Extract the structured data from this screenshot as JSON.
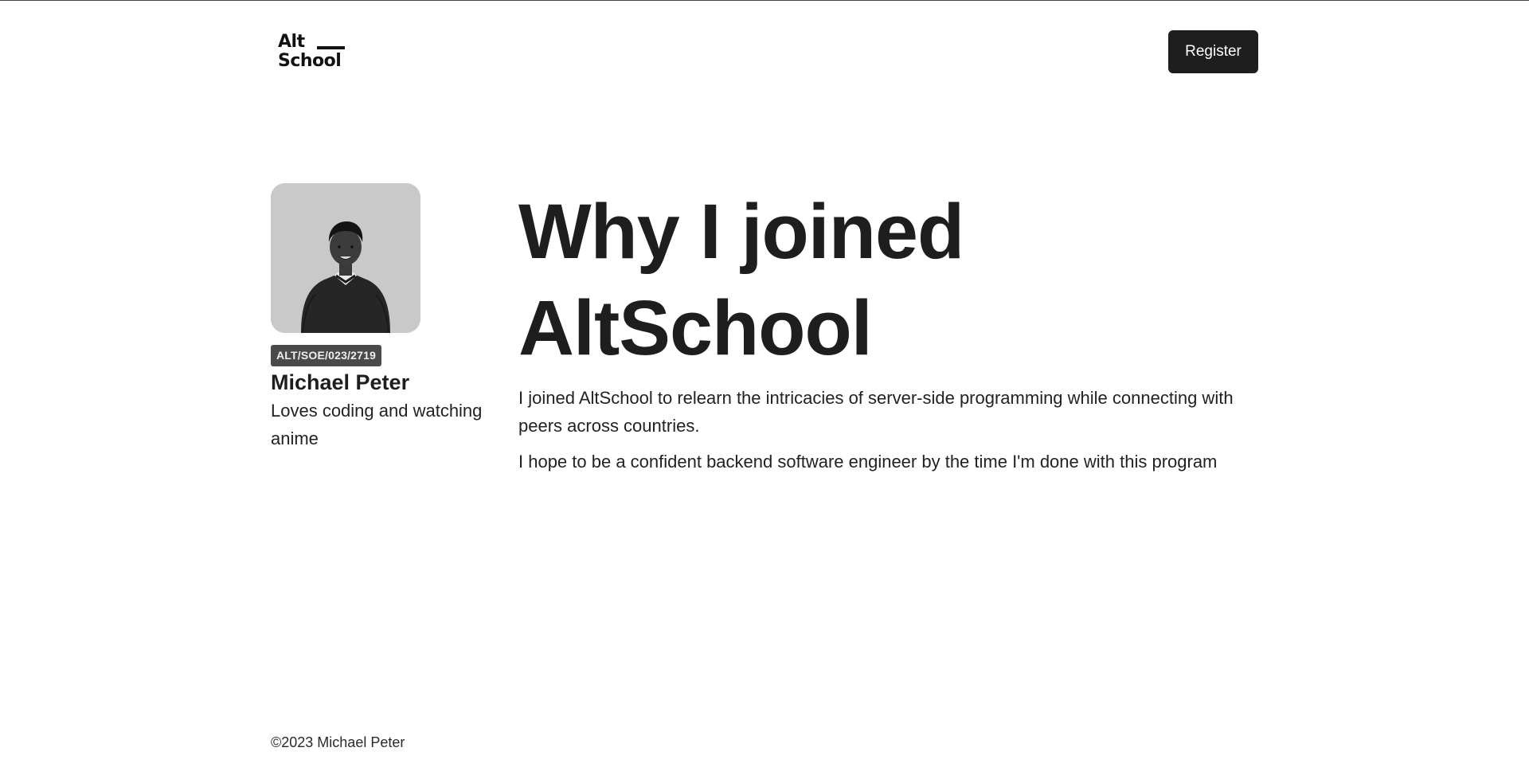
{
  "header": {
    "logo_line1": "Alt",
    "logo_line2": "School",
    "register_label": "Register"
  },
  "profile": {
    "photo_icon": "person-photo",
    "student_id": "ALT/SOE/023/2719",
    "name": "Michael Peter",
    "bio": "Loves coding and watching anime"
  },
  "article": {
    "title_line1": "Why I joined",
    "title_line2": "AltSchool",
    "paragraphs": [
      "I joined AltSchool to relearn the intricacies of server-side programming while connecting with peers across countries.",
      "I hope to be a confident backend software engineer by the time I'm done with this program"
    ]
  },
  "footer": {
    "copyright": "©2023 Michael Peter"
  },
  "colors": {
    "text": "#1e1e1e",
    "button_bg": "#1e1e1e",
    "badge_bg": "#4a4a4a",
    "avatar_bg": "#c9c9c9"
  }
}
